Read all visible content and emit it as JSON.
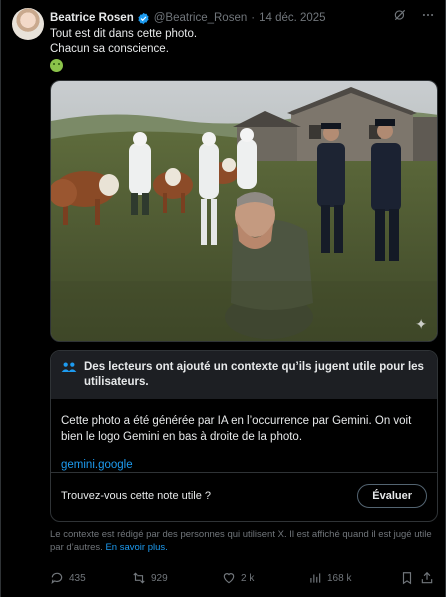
{
  "post": {
    "author_name": "Beatrice Rosen",
    "handle": "@Beatrice_Rosen",
    "separator": "·",
    "date": "14 déc. 2025",
    "text_line1": "Tout est dit dans cette photo.",
    "text_line2": "Chacun sa conscience.",
    "emoji_icon": "nauseated-face-icon",
    "verified_color": "#1d9bf0"
  },
  "note": {
    "title": "Des lecteurs ont ajouté un contexte qu’ils jugent utile pour les utilisateurs.",
    "body": "Cette photo a été générée par IA en l’occurrence par Gemini. On voit bien le logo Gemini en bas à droite de la photo.",
    "link": "gemini.google",
    "question": "Trouvez-vous cette note utile ?",
    "button": "Évaluer"
  },
  "context": {
    "text": "Le contexte est rédigé par des personnes qui utilisent X. Il est affiché quand il est jugé utile par d’autres.",
    "link": "En savoir plus."
  },
  "actions": {
    "replies": "435",
    "reposts": "929",
    "likes": "2 k",
    "views": "168 k"
  },
  "colors": {
    "background": "#000000",
    "accent": "#1d9bf0",
    "muted": "#71767b",
    "border": "#2f3336"
  }
}
